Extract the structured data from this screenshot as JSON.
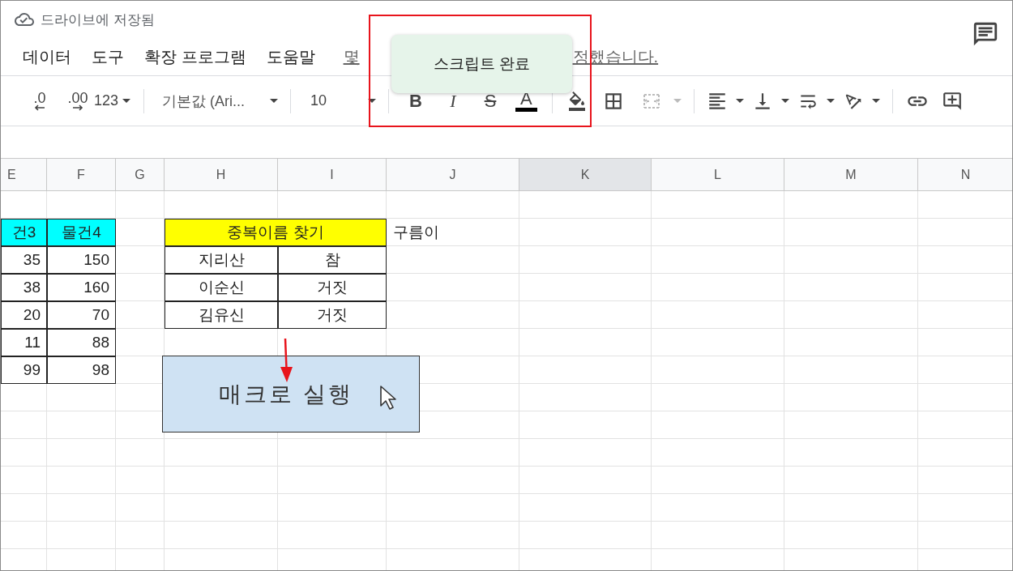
{
  "save_status": "드라이브에 저장됨",
  "menu": [
    "데이터",
    "도구",
    "확장 프로그램",
    "도움말"
  ],
  "last_edit": {
    "start": "몇",
    "end": "정했습니다."
  },
  "toast": {
    "text": "스크립트 완료"
  },
  "toolbar": {
    "decimal_decrease": ".0",
    "decimal_increase": ".00",
    "number_format": "123",
    "font": "기본값 (Ari...",
    "font_size": "10",
    "bold": "B",
    "italic": "I",
    "strikethrough": "S",
    "text_color": "A"
  },
  "columns": [
    {
      "label": "E",
      "selected": false
    },
    {
      "label": "F",
      "selected": false
    },
    {
      "label": "G",
      "selected": false
    },
    {
      "label": "H",
      "selected": false
    },
    {
      "label": "I",
      "selected": false
    },
    {
      "label": "J",
      "selected": false
    },
    {
      "label": "K",
      "selected": true
    },
    {
      "label": "L",
      "selected": false
    },
    {
      "label": "M",
      "selected": false
    },
    {
      "label": "N",
      "selected": false
    }
  ],
  "rows": [
    {
      "cells": [
        {
          "kind": "header",
          "text": "건3"
        },
        {
          "kind": "header",
          "text": "물건4"
        },
        {
          "kind": "empty"
        },
        {
          "kind": "title",
          "text": "중복이름 찾기"
        },
        {
          "kind": "note",
          "text": "구름이"
        }
      ]
    },
    {
      "cells": [
        {
          "kind": "number",
          "text": "35"
        },
        {
          "kind": "number",
          "text": "150"
        },
        {
          "kind": "empty"
        },
        {
          "kind": "name",
          "text": "지리산"
        },
        {
          "kind": "name",
          "text": "참"
        }
      ]
    },
    {
      "cells": [
        {
          "kind": "number",
          "text": "38"
        },
        {
          "kind": "number",
          "text": "160"
        },
        {
          "kind": "empty"
        },
        {
          "kind": "name",
          "text": "이순신"
        },
        {
          "kind": "name",
          "text": "거짓"
        }
      ]
    },
    {
      "cells": [
        {
          "kind": "number",
          "text": "20"
        },
        {
          "kind": "number",
          "text": "70"
        },
        {
          "kind": "empty"
        },
        {
          "kind": "name",
          "text": "김유신"
        },
        {
          "kind": "name",
          "text": "거짓"
        }
      ]
    },
    {
      "cells": [
        {
          "kind": "number",
          "text": "11"
        },
        {
          "kind": "number",
          "text": "88"
        }
      ]
    },
    {
      "cells": [
        {
          "kind": "number",
          "text": "99"
        },
        {
          "kind": "number",
          "text": "98"
        }
      ]
    }
  ],
  "macro_button": {
    "label": "매크로 실행"
  }
}
